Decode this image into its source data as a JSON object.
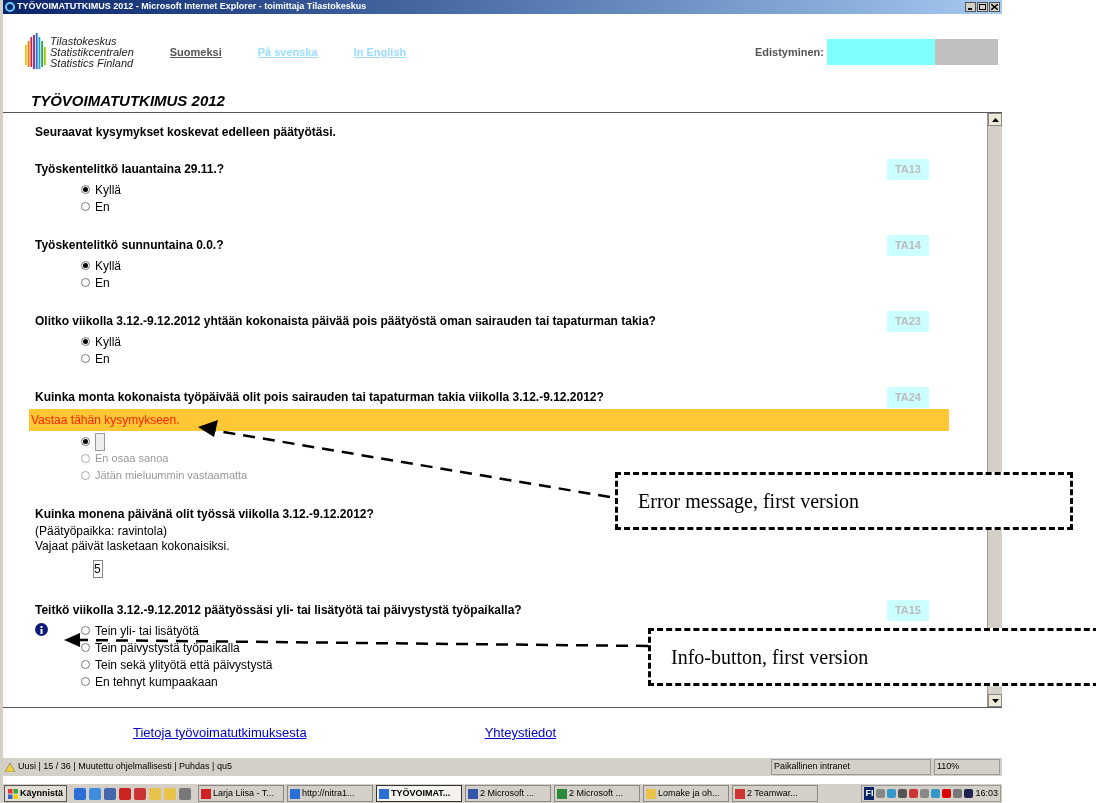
{
  "window": {
    "title": "TYÖVOIMATUTKIMUS 2012 - Microsoft Internet Explorer - toimittaja Tilastokeskus"
  },
  "header": {
    "logo_lines": [
      "Tilastokeskus",
      "Statistikcentralen",
      "Statistics Finland"
    ],
    "languages": [
      {
        "label": "Suomeksi",
        "selected": true
      },
      {
        "label": "På svenska",
        "selected": false
      },
      {
        "label": "In English",
        "selected": false
      }
    ],
    "progress": {
      "label": "Edistyminen:",
      "level": 0.63
    }
  },
  "page_title": "TYÖVOIMATUTKIMUS 2012",
  "intro": "Seuraavat kysymykset koskevat edelleen päätyötäsi.",
  "questions": [
    {
      "kind": "radio",
      "text": "Työskentelitkö lauantaina 29.11.?",
      "code": "TA13",
      "options": [
        {
          "label": "Kyllä",
          "selected": true,
          "disabled": false
        },
        {
          "label": "En",
          "selected": false,
          "disabled": false
        }
      ]
    },
    {
      "kind": "radio",
      "text": "Työskentelitkö sunnuntaina 0.0.?",
      "code": "TA14",
      "options": [
        {
          "label": "Kyllä",
          "selected": true,
          "disabled": false
        },
        {
          "label": "En",
          "selected": false,
          "disabled": false
        }
      ]
    },
    {
      "kind": "radio",
      "text": "Olitko viikolla 3.12.-9.12.2012 yhtään kokonaista päivää pois päätyöstä oman sairauden tai tapaturman takia?",
      "code": "TA23",
      "options": [
        {
          "label": "Kyllä",
          "selected": true,
          "disabled": false
        },
        {
          "label": "En",
          "selected": false,
          "disabled": false
        }
      ]
    },
    {
      "kind": "radio",
      "text": "Kuinka monta kokonaista työpäivää olit pois sairauden tai tapaturman takia viikolla 3.12.-9.12.2012?",
      "code": "TA24",
      "error": "Vastaa tähän kysymykseen.",
      "options": [
        {
          "kind": "input",
          "selected": true,
          "disabled": false
        },
        {
          "label": "En osaa sanoa",
          "selected": false,
          "disabled": true
        },
        {
          "label": "Jätän mieluummin vastaamatta",
          "selected": false,
          "disabled": true
        }
      ]
    },
    {
      "kind": "number",
      "text": "Kuinka monena päivänä olit työssä viikolla 3.12.-9.12.2012?",
      "notes": [
        "(Päätyöpaikka: ravintola)",
        "Vajaat päivät lasketaan kokonaisiksi."
      ],
      "value": "5"
    },
    {
      "kind": "radio",
      "text": "Teitkö viikolla 3.12.-9.12.2012 päätyössäsi yli- tai lisätyötä tai päivystystä työpaikalla?",
      "code": "TA15",
      "info_button": true,
      "options": [
        {
          "label": "Tein yli- tai lisätyötä",
          "selected": false,
          "disabled": false
        },
        {
          "label": "Tein päivystystä työpaikalla",
          "selected": false,
          "disabled": false
        },
        {
          "label": "Tein sekä ylityötä että päivystystä",
          "selected": false,
          "disabled": false
        },
        {
          "label": "En tehnyt kumpaakaan",
          "selected": false,
          "disabled": false
        }
      ]
    }
  ],
  "footer_links": [
    "Tietoja työvoimatutkimuksesta",
    "Yhteystiedot"
  ],
  "status_bar": {
    "text": "Uusi | 15 / 36 | Muutettu ohjelmallisesti | Puhdas | qu5",
    "zone": "Paikallinen intranet",
    "zoom": "110%"
  },
  "taskbar": {
    "start": "Käynnistä",
    "tasks": [
      {
        "label": "Larja Liisa - T...",
        "selected": false
      },
      {
        "label": "http://nitra1...",
        "selected": false
      },
      {
        "label": "TYÖVOIMAT...",
        "selected": true
      },
      {
        "label": "2 Microsoft ...",
        "selected": false
      },
      {
        "label": "2 Microsoft ...",
        "selected": false
      },
      {
        "label": "Lomake ja oh...",
        "selected": false
      },
      {
        "label": "2 Teamwar...",
        "selected": false
      }
    ],
    "language": "FI",
    "clock": "16:03"
  },
  "annotations": [
    "Error message, first version",
    "Info-button, first version"
  ]
}
